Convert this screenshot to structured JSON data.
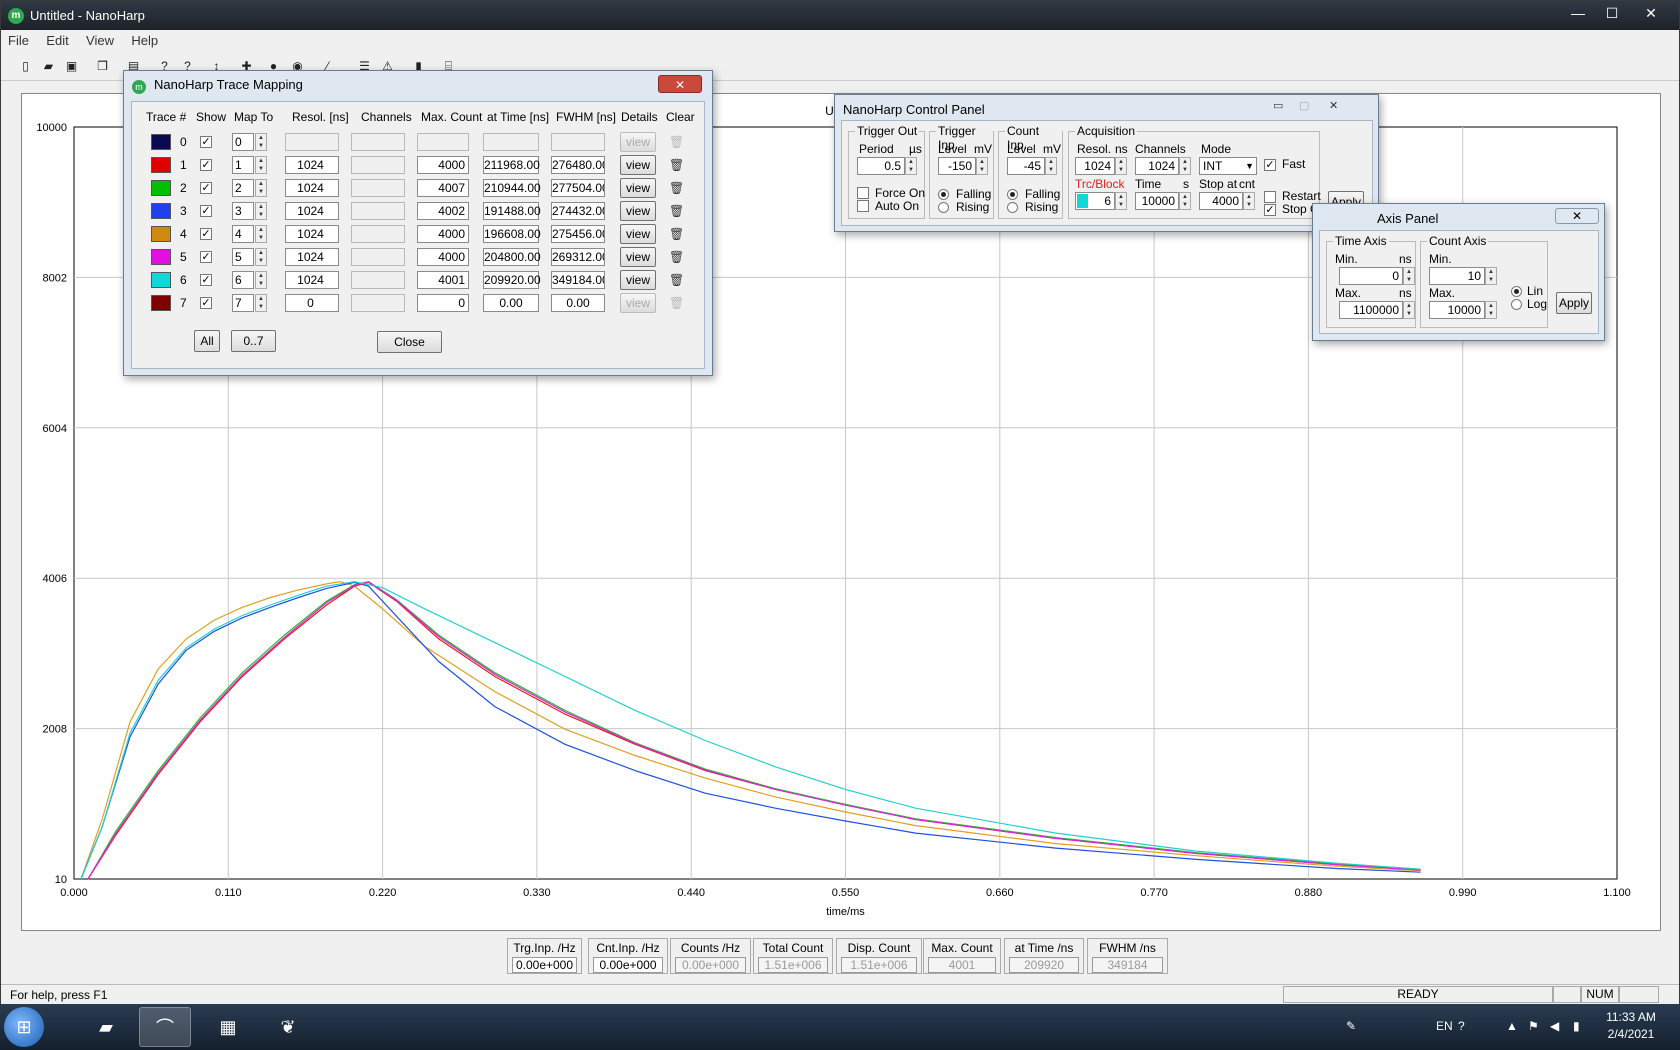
{
  "window": {
    "title": "Untitled - NanoHarp",
    "minimize": "—",
    "maximize": "☐",
    "close": "✕"
  },
  "menu": [
    "File",
    "Edit",
    "View",
    "Help"
  ],
  "chart_data": {
    "type": "line",
    "title": "Untitled",
    "xlabel": "time/ms",
    "ylabel": "",
    "xlim": [
      0.0,
      1.1
    ],
    "ylim": [
      10,
      10000
    ],
    "xticks": [
      "0.000",
      "0.110",
      "0.220",
      "0.330",
      "0.440",
      "0.550",
      "0.660",
      "0.770",
      "0.880",
      "0.990",
      "1.100"
    ],
    "yticks": [
      "10",
      "2008",
      "4006",
      "6004",
      "8002",
      "10000"
    ],
    "grid": true,
    "series": [
      {
        "color": "#e0a020",
        "x": [
          0.005,
          0.02,
          0.04,
          0.06,
          0.08,
          0.1,
          0.12,
          0.14,
          0.16,
          0.18,
          0.19,
          0.2,
          0.22,
          0.25,
          0.3,
          0.35,
          0.4,
          0.45,
          0.5,
          0.55,
          0.6,
          0.7,
          0.8,
          0.9,
          0.96
        ],
        "y": [
          10,
          800,
          2100,
          2800,
          3200,
          3450,
          3620,
          3750,
          3850,
          3930,
          3960,
          3900,
          3600,
          3100,
          2500,
          2000,
          1650,
          1350,
          1100,
          900,
          720,
          480,
          320,
          180,
          120
        ]
      },
      {
        "color": "#2050e0",
        "x": [
          0.005,
          0.02,
          0.04,
          0.06,
          0.08,
          0.1,
          0.12,
          0.14,
          0.16,
          0.18,
          0.2,
          0.21,
          0.23,
          0.26,
          0.3,
          0.35,
          0.4,
          0.45,
          0.5,
          0.55,
          0.6,
          0.7,
          0.8,
          0.9,
          0.96
        ],
        "y": [
          10,
          700,
          1900,
          2600,
          3050,
          3300,
          3480,
          3620,
          3750,
          3870,
          3950,
          3900,
          3500,
          2900,
          2300,
          1800,
          1450,
          1150,
          950,
          780,
          620,
          420,
          270,
          150,
          100
        ]
      },
      {
        "color": "#e02020",
        "x": [
          0.01,
          0.03,
          0.06,
          0.09,
          0.12,
          0.15,
          0.18,
          0.2,
          0.21,
          0.23,
          0.26,
          0.3,
          0.35,
          0.4,
          0.45,
          0.5,
          0.55,
          0.6,
          0.7,
          0.8,
          0.9,
          0.96
        ],
        "y": [
          10,
          600,
          1400,
          2100,
          2700,
          3200,
          3650,
          3900,
          3950,
          3700,
          3200,
          2700,
          2200,
          1800,
          1450,
          1200,
          1000,
          800,
          550,
          350,
          200,
          130
        ]
      },
      {
        "color": "#20c020",
        "x": [
          0.01,
          0.03,
          0.06,
          0.09,
          0.12,
          0.15,
          0.18,
          0.2,
          0.21,
          0.23,
          0.26,
          0.3,
          0.35,
          0.4,
          0.45,
          0.5,
          0.55,
          0.6,
          0.7,
          0.8,
          0.9,
          0.96
        ],
        "y": [
          10,
          650,
          1450,
          2150,
          2750,
          3250,
          3700,
          3920,
          3960,
          3720,
          3250,
          2750,
          2250,
          1820,
          1470,
          1210,
          1000,
          810,
          560,
          360,
          210,
          140
        ]
      },
      {
        "color": "#e020e0",
        "x": [
          0.01,
          0.03,
          0.06,
          0.09,
          0.12,
          0.15,
          0.18,
          0.2,
          0.21,
          0.23,
          0.26,
          0.3,
          0.35,
          0.4,
          0.45,
          0.5,
          0.55,
          0.6,
          0.7,
          0.8,
          0.9,
          0.96
        ],
        "y": [
          10,
          620,
          1420,
          2120,
          2720,
          3220,
          3680,
          3910,
          3955,
          3710,
          3230,
          2730,
          2230,
          1810,
          1460,
          1200,
          990,
          800,
          550,
          350,
          200,
          130
        ]
      },
      {
        "color": "#20d0d0",
        "x": [
          0.005,
          0.02,
          0.04,
          0.06,
          0.08,
          0.1,
          0.12,
          0.14,
          0.16,
          0.18,
          0.2,
          0.22,
          0.25,
          0.3,
          0.35,
          0.4,
          0.45,
          0.5,
          0.55,
          0.6,
          0.7,
          0.8,
          0.9,
          0.96
        ],
        "y": [
          10,
          700,
          1950,
          2650,
          3080,
          3330,
          3510,
          3650,
          3780,
          3900,
          3960,
          3880,
          3600,
          3150,
          2700,
          2250,
          1850,
          1500,
          1200,
          950,
          620,
          380,
          220,
          140
        ]
      }
    ]
  },
  "trace_dialog": {
    "title": "NanoHarp Trace Mapping",
    "close": "✕",
    "headers": [
      "Trace #",
      "Show",
      "Map To",
      "Resol. [ns]",
      "Channels",
      "Max. Count",
      "at Time [ns]",
      "FWHM [ns]",
      "Details",
      "Clear"
    ],
    "rows": [
      {
        "num": "0",
        "color": "#0a0a50",
        "map": "0",
        "resol": "",
        "channels": "",
        "maxcount": "",
        "attime": "",
        "fwhm": "",
        "view": "view",
        "enabled": false
      },
      {
        "num": "1",
        "color": "#e00000",
        "map": "1",
        "resol": "1024",
        "channels": "",
        "maxcount": "4000",
        "attime": "211968.00",
        "fwhm": "276480.00",
        "view": "view",
        "enabled": true
      },
      {
        "num": "2",
        "color": "#00c000",
        "map": "2",
        "resol": "1024",
        "channels": "",
        "maxcount": "4007",
        "attime": "210944.00",
        "fwhm": "277504.00",
        "view": "view",
        "enabled": true
      },
      {
        "num": "3",
        "color": "#2040f0",
        "map": "3",
        "resol": "1024",
        "channels": "",
        "maxcount": "4002",
        "attime": "191488.00",
        "fwhm": "274432.00",
        "view": "view",
        "enabled": true
      },
      {
        "num": "4",
        "color": "#d08a10",
        "map": "4",
        "resol": "1024",
        "channels": "",
        "maxcount": "4000",
        "attime": "196608.00",
        "fwhm": "275456.00",
        "view": "view",
        "enabled": true
      },
      {
        "num": "5",
        "color": "#e010e0",
        "map": "5",
        "resol": "1024",
        "channels": "",
        "maxcount": "4000",
        "attime": "204800.00",
        "fwhm": "269312.00",
        "view": "view",
        "enabled": true
      },
      {
        "num": "6",
        "color": "#10d8d8",
        "map": "6",
        "resol": "1024",
        "channels": "",
        "maxcount": "4001",
        "attime": "209920.00",
        "fwhm": "349184.00",
        "view": "view",
        "enabled": true
      },
      {
        "num": "7",
        "color": "#800000",
        "map": "7",
        "resol": "0",
        "channels": "",
        "maxcount": "0",
        "attime": "0.00",
        "fwhm": "0.00",
        "view": "view",
        "enabled": false
      }
    ],
    "all_btn": "All",
    "range_btn": "0..7",
    "close_btn": "Close"
  },
  "control_panel": {
    "title": "NanoHarp Control Panel",
    "trigger_out": {
      "label": "Trigger Out",
      "period_label": "Period",
      "period_unit": "µs",
      "period": "0.5",
      "force_on": "Force On",
      "auto_on": "Auto On"
    },
    "trigger_inp": {
      "label": "Trigger Inp.",
      "level_label": "Level",
      "level_unit": "mV",
      "level": "-150",
      "falling": "Falling",
      "rising": "Rising"
    },
    "count_inp": {
      "label": "Count Inp.",
      "level_label": "Level",
      "level_unit": "mV",
      "level": "-45",
      "falling": "Falling",
      "rising": "Rising"
    },
    "acquisition": {
      "label": "Acquisition",
      "resol_label": "Resol.",
      "resol_unit": "ns",
      "resol": "1024",
      "channels_label": "Channels",
      "channels": "1024",
      "mode_label": "Mode",
      "mode": "INT",
      "fast": "Fast",
      "trc_label": "Trc/Block",
      "trc": "6",
      "time_label": "Time",
      "time_unit": "s",
      "time": "10000",
      "stop_label": "Stop at",
      "stop_unit": "cnt",
      "stop": "4000",
      "restart": "Restart",
      "stop_of": "Stop Of"
    },
    "apply": "Apply"
  },
  "axis_panel": {
    "title": "Axis Panel",
    "time_axis": {
      "label": "Time Axis",
      "min_label": "Min.",
      "unit": "ns",
      "min": "0",
      "max_label": "Max.",
      "max": "1100000"
    },
    "count_axis": {
      "label": "Count Axis",
      "min_label": "Min.",
      "min": "10",
      "max_label": "Max.",
      "max": "10000"
    },
    "lin": "Lin",
    "log": "Log",
    "apply": "Apply"
  },
  "readouts": [
    {
      "label": "Trg.Inp. /Hz",
      "value": "0.00e+000",
      "gray": false
    },
    {
      "label": "Cnt.Inp. /Hz",
      "value": "0.00e+000",
      "gray": false
    },
    {
      "label": "Counts /Hz",
      "value": "0.00e+000",
      "gray": true
    },
    {
      "label": "Total Count",
      "value": "1.51e+006",
      "gray": true
    },
    {
      "label": "Disp. Count",
      "value": "1.51e+006",
      "gray": true
    },
    {
      "label": "Max. Count",
      "value": "4001",
      "gray": true
    },
    {
      "label": "at Time /ns",
      "value": "209920",
      "gray": true
    },
    {
      "label": "FWHM  /ns",
      "value": "349184",
      "gray": true
    }
  ],
  "status": {
    "help": "For help, press F1",
    "ready": "READY",
    "num": "NUM"
  },
  "taskbar": {
    "lang": "EN",
    "time": "11:33 AM",
    "date": "2/4/2021"
  }
}
